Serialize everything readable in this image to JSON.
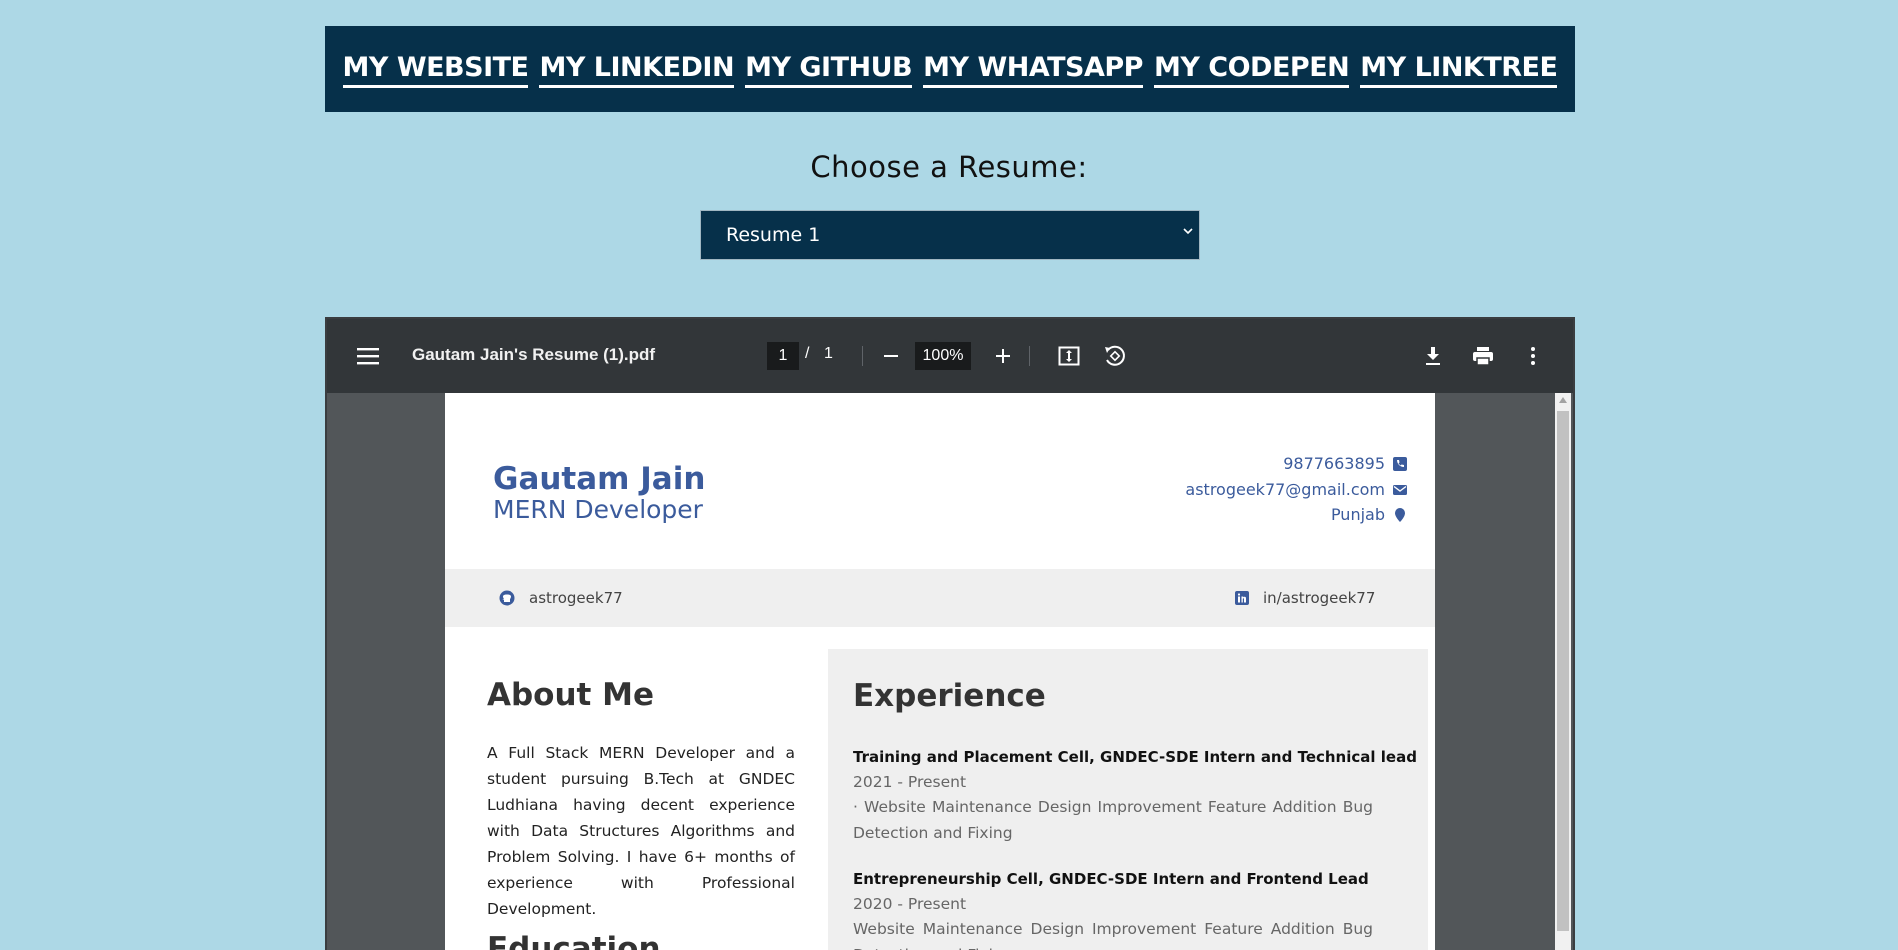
{
  "nav": {
    "links": [
      "MY WEBSITE",
      "MY LINKEDIN",
      "MY GITHUB",
      "MY WHATSAPP",
      "MY CODEPEN",
      "MY LINKTREE"
    ]
  },
  "chooser": {
    "label": "Choose a Resume:",
    "selected": "Resume 1"
  },
  "viewer": {
    "file_title": "Gautam Jain's Resume (1).pdf",
    "current_page": "1",
    "page_separator": "/",
    "total_pages": "1",
    "zoom": "100%",
    "icons": [
      "menu-icon",
      "zoom-out-icon",
      "zoom-in-icon",
      "fit-page-icon",
      "rotate-icon",
      "download-icon",
      "print-icon",
      "more-icon"
    ]
  },
  "resume": {
    "name": "Gautam Jain",
    "role": "MERN Developer",
    "phone": "9877663895",
    "email": "astrogeek77@gmail.com",
    "location": "Punjab",
    "github": "astrogeek77",
    "linkedin": "in/astrogeek77",
    "about_heading": "About Me",
    "about_text": "A Full Stack MERN Developer and a student pursuing B.Tech at GNDEC Ludhiana having decent experience with Data Structures Algorithms and Problem Solving. I have 6+ months of experience with Professional Development.",
    "education_heading": "Education",
    "experience_heading": "Experience",
    "experience": [
      {
        "title": "Training and Placement Cell, GNDEC-SDE Intern and Technical lead",
        "date": "2021 - Present",
        "desc": "· Website Maintenance Design Improvement Feature Addition Bug Detection and Fixing"
      },
      {
        "title": "Entrepreneurship Cell, GNDEC-SDE Intern and Frontend Lead",
        "date": "2020 - Present",
        "desc": "Website Maintenance Design Improvement Feature Addition Bug Detection and Fixing"
      }
    ]
  },
  "colors": {
    "background": "#add8e6",
    "nav_bg": "#06304a",
    "resume_accent": "#3b5b9c",
    "viewer_toolbar": "#323639"
  }
}
